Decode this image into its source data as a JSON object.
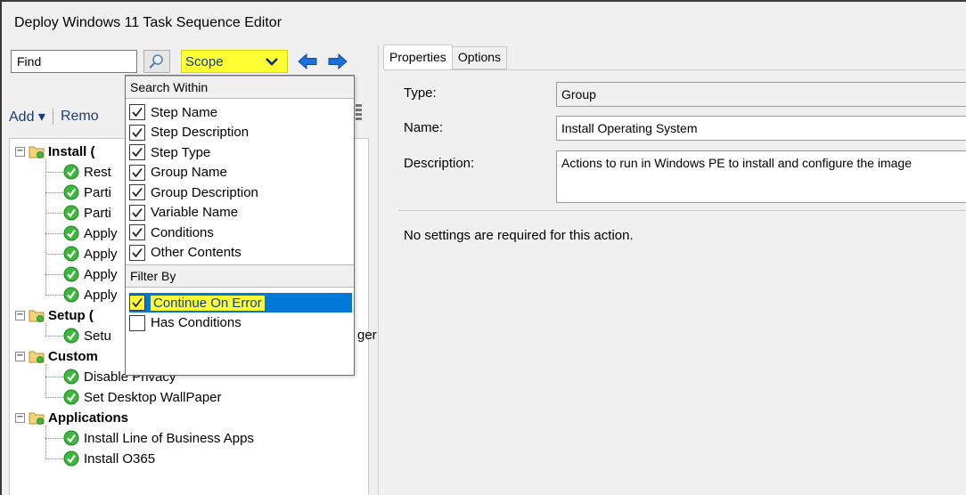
{
  "window": {
    "title": "Deploy Windows 11 Task Sequence Editor"
  },
  "search": {
    "placeholder": "Find",
    "scope_label": "Scope"
  },
  "toolbar": {
    "add_label": "Add ▾",
    "remove_label": "Remo"
  },
  "tree": {
    "rows": [
      {
        "label": "Install (",
        "type": "group"
      },
      {
        "label": "Rest",
        "type": "step"
      },
      {
        "label": "Parti",
        "type": "step"
      },
      {
        "label": "Parti",
        "type": "step"
      },
      {
        "label": "Apply",
        "type": "step"
      },
      {
        "label": "Apply",
        "type": "step"
      },
      {
        "label": "Apply",
        "type": "step"
      },
      {
        "label": "Apply",
        "type": "step"
      },
      {
        "label": "Setup (",
        "type": "group"
      },
      {
        "label": "Setu",
        "type": "step"
      },
      {
        "label": "Custom",
        "type": "group"
      },
      {
        "label": "Disable Privacy",
        "type": "step"
      },
      {
        "label": "Set Desktop WallPaper",
        "type": "step"
      },
      {
        "label": "Applications",
        "type": "group"
      },
      {
        "label": "Install Line of Business Apps",
        "type": "step"
      },
      {
        "label": "Install O365",
        "type": "step"
      }
    ],
    "partial_text": "ger"
  },
  "dropdown": {
    "search_within_header": "Search Within",
    "search_within": [
      {
        "label": "Step Name",
        "checked": true
      },
      {
        "label": "Step Description",
        "checked": true
      },
      {
        "label": "Step Type",
        "checked": true
      },
      {
        "label": "Group Name",
        "checked": true
      },
      {
        "label": "Group Description",
        "checked": true
      },
      {
        "label": "Variable Name",
        "checked": true
      },
      {
        "label": "Conditions",
        "checked": true
      },
      {
        "label": "Other Contents",
        "checked": true
      }
    ],
    "filter_by_header": "Filter By",
    "filter_by": [
      {
        "label": "Continue On Error",
        "checked": true,
        "highlighted": true
      },
      {
        "label": "Has Conditions",
        "checked": false,
        "highlighted": false
      }
    ]
  },
  "tabs": [
    {
      "label": "Properties",
      "active": true
    },
    {
      "label": "Options",
      "active": false
    }
  ],
  "properties": {
    "type_label": "Type:",
    "type_value": "Group",
    "name_label": "Name:",
    "name_value": "Install Operating System",
    "description_label": "Description:",
    "description_value": "Actions to run in Windows PE to install and configure the image",
    "note": "No settings are required  for this action."
  },
  "colors": {
    "highlight_yellow": "#ffff33",
    "selection_blue": "#0078d7",
    "check_green": "#3cb93c",
    "arrow_blue": "#1e6fd9"
  }
}
